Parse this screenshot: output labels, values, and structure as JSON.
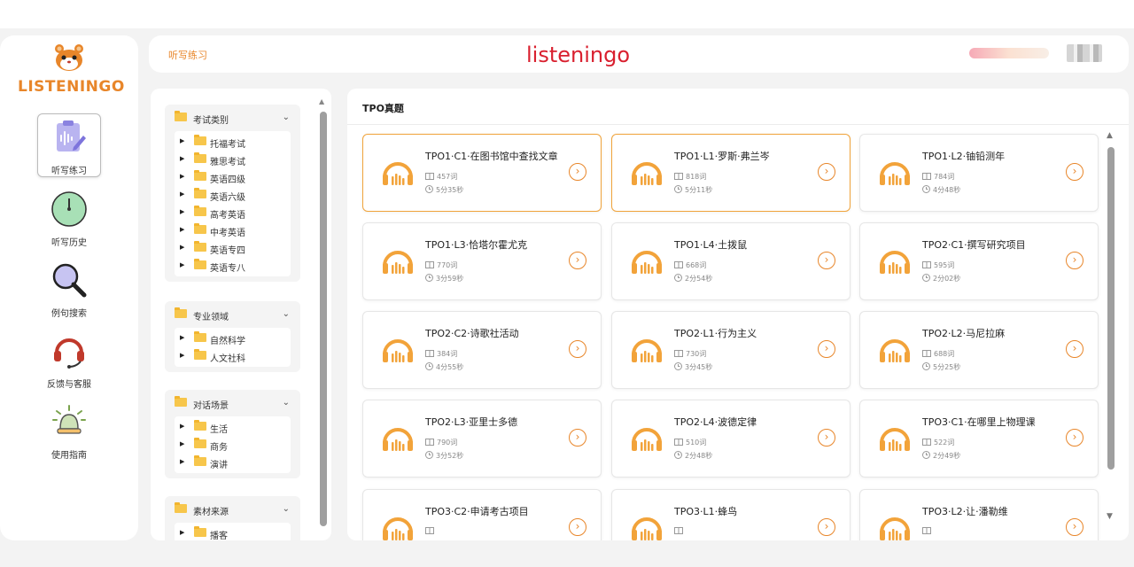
{
  "app": {
    "logo_text": "LISTENINGO",
    "title": "listeningo",
    "breadcrumb": "听写练习"
  },
  "colors": {
    "accent": "#e8862a",
    "title_red": "#d9202f",
    "highlight_border": "#f0a33a"
  },
  "nav": [
    {
      "label": "听写练习",
      "icon": "clipboard-audio-icon",
      "active": true
    },
    {
      "label": "听写历史",
      "icon": "clock-icon",
      "active": false
    },
    {
      "label": "例句搜索",
      "icon": "magnifier-icon",
      "active": false
    },
    {
      "label": "反馈与客服",
      "icon": "headset-icon",
      "active": false
    },
    {
      "label": "使用指南",
      "icon": "bell-icon",
      "active": false
    }
  ],
  "filters": [
    {
      "title": "考试类别",
      "items": [
        "托福考试",
        "雅思考试",
        "英语四级",
        "英语六级",
        "高考英语",
        "中考英语",
        "英语专四",
        "英语专八"
      ]
    },
    {
      "title": "专业领域",
      "items": [
        "自然科学",
        "人文社科"
      ]
    },
    {
      "title": "对话场景",
      "items": [
        "生活",
        "商务",
        "演讲"
      ]
    },
    {
      "title": "素材来源",
      "items": [
        "播客"
      ]
    }
  ],
  "content": {
    "section_title": "TPO真题",
    "cards": [
      {
        "title": "TPO1·C1·在图书馆中查找文章",
        "words": "457词",
        "duration": "5分35秒",
        "highlight": true
      },
      {
        "title": "TPO1·L1·罗斯·弗兰岑",
        "words": "818词",
        "duration": "5分11秒",
        "highlight": true
      },
      {
        "title": "TPO1·L2·铀铅测年",
        "words": "784词",
        "duration": "4分48秒",
        "highlight": false
      },
      {
        "title": "TPO1·L3·恰塔尔霍尤克",
        "words": "770词",
        "duration": "3分59秒",
        "highlight": false
      },
      {
        "title": "TPO1·L4·土拨鼠",
        "words": "668词",
        "duration": "2分54秒",
        "highlight": false
      },
      {
        "title": "TPO2·C1·撰写研究项目",
        "words": "595词",
        "duration": "2分02秒",
        "highlight": false
      },
      {
        "title": "TPO2·C2·诗歌社活动",
        "words": "384词",
        "duration": "4分55秒",
        "highlight": false
      },
      {
        "title": "TPO2·L1·行为主义",
        "words": "730词",
        "duration": "3分45秒",
        "highlight": false
      },
      {
        "title": "TPO2·L2·马尼拉麻",
        "words": "688词",
        "duration": "5分25秒",
        "highlight": false
      },
      {
        "title": "TPO2·L3·亚里士多德",
        "words": "790词",
        "duration": "3分52秒",
        "highlight": false
      },
      {
        "title": "TPO2·L4·波德定律",
        "words": "510词",
        "duration": "2分48秒",
        "highlight": false
      },
      {
        "title": "TPO3·C1·在哪里上物理课",
        "words": "522词",
        "duration": "2分49秒",
        "highlight": false
      },
      {
        "title": "TPO3·C2·申请考古项目",
        "words": "",
        "duration": "",
        "highlight": false
      },
      {
        "title": "TPO3·L1·蜂鸟",
        "words": "",
        "duration": "",
        "highlight": false
      },
      {
        "title": "TPO3·L2·让·潘勒维",
        "words": "",
        "duration": "",
        "highlight": false
      }
    ]
  }
}
